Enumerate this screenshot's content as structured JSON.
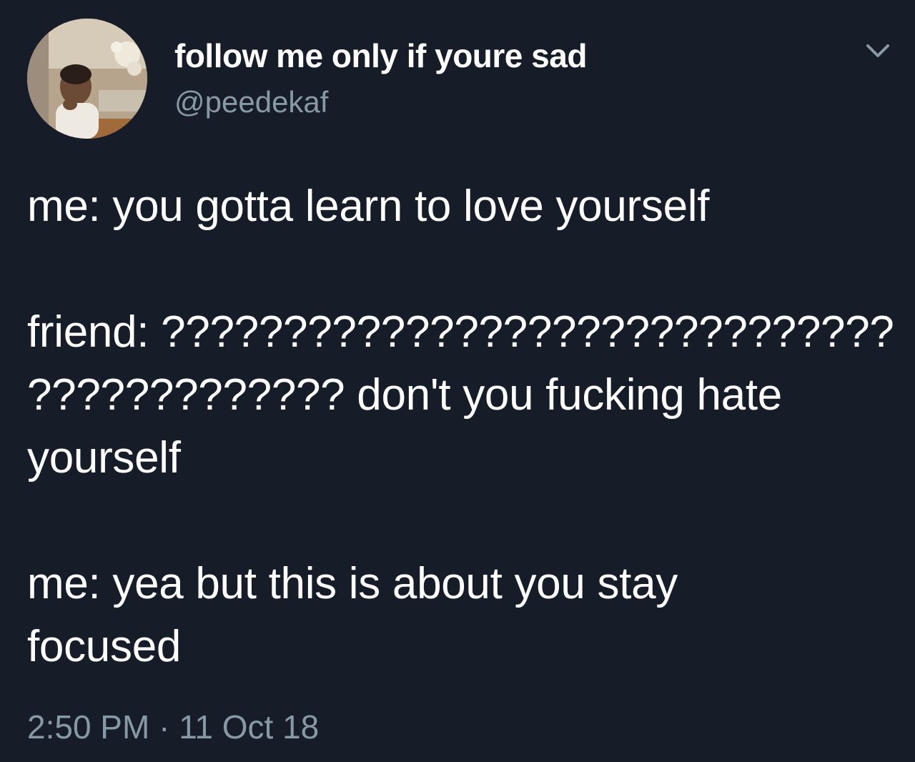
{
  "user": {
    "display_name": "follow me only if youre sad",
    "handle": "@peedekaf",
    "avatar_icon": "profile-photo"
  },
  "menu": {
    "icon": "chevron-down-icon"
  },
  "tweet": {
    "lines": [
      "me: you gotta learn to love yourself",
      "",
      "friend: ??????????????????????????????",
      "????????????? don't you fucking hate",
      "yourself",
      "",
      "me: yea but this is about you stay",
      "focused"
    ]
  },
  "meta": {
    "time": "2:50 PM",
    "separator": " · ",
    "date": "11 Oct 18"
  },
  "colors": {
    "background": "#161d28",
    "text": "#ffffff",
    "secondary": "#8899a6"
  }
}
